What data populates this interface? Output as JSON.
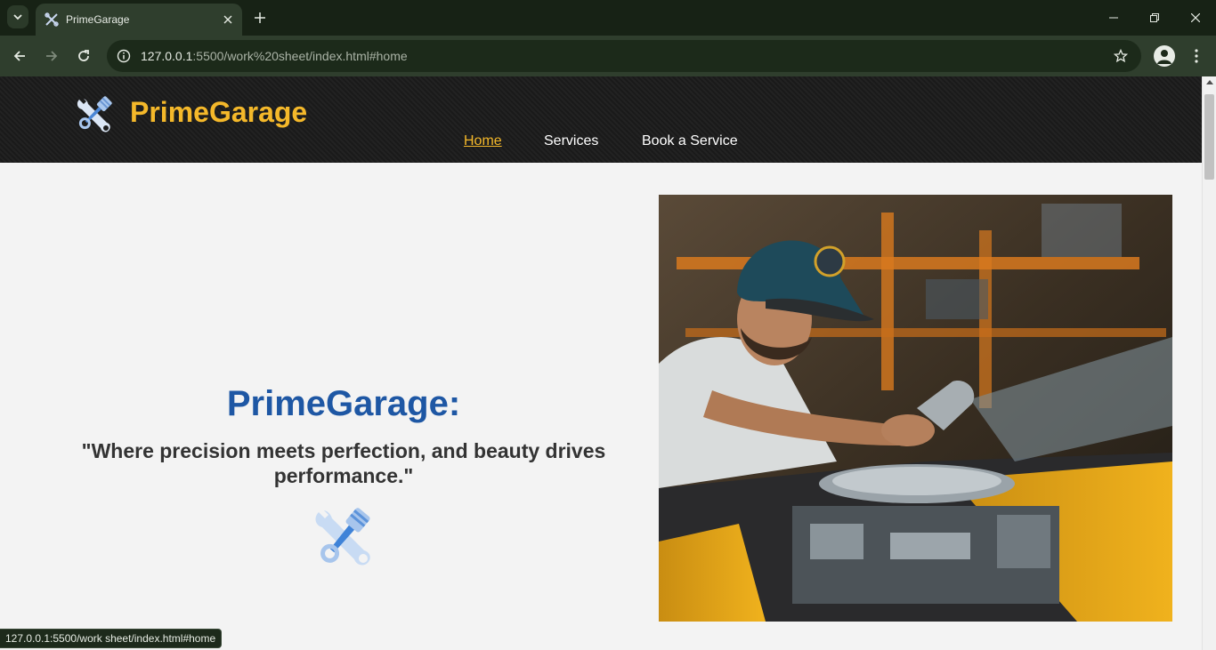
{
  "browser": {
    "tab_title": "PrimeGarage",
    "url_host": "127.0.0.1",
    "url_rest": ":5500/work%20sheet/index.html#home",
    "status_url": "127.0.0.1:5500/work sheet/index.html#home"
  },
  "site": {
    "brand": "PrimeGarage",
    "nav": [
      {
        "label": "Home",
        "active": true
      },
      {
        "label": "Services",
        "active": false
      },
      {
        "label": "Book a Service",
        "active": false
      }
    ]
  },
  "hero": {
    "title": "PrimeGarage:",
    "quote": "\"Where precision meets perfection, and beauty drives performance.\"",
    "photo_subject": "mechanic-working-on-engine"
  },
  "colors": {
    "brand_gold": "#f4b82a",
    "title_blue": "#1e57a4",
    "header_dark": "#1c1c1c",
    "chrome_green": "#2f3e2d"
  },
  "icons": {
    "tab_favicon": "wrench-piston-icon",
    "logo": "wrench-piston-icon",
    "hero_emblem": "wrench-piston-icon"
  }
}
